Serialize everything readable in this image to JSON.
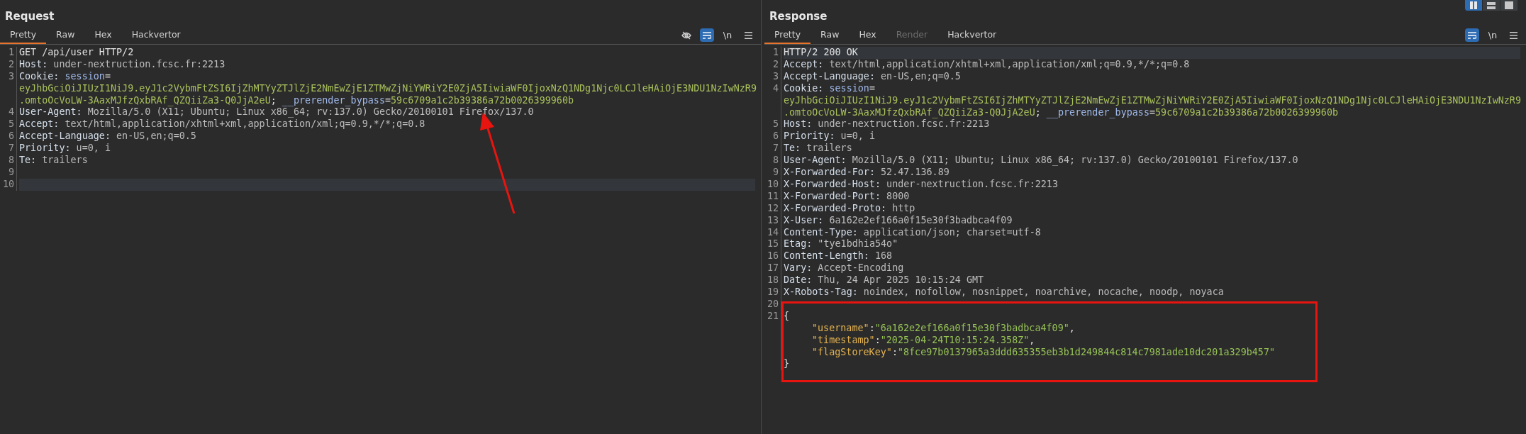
{
  "layout_toggles": [
    {
      "kind": "columns",
      "selected": true
    },
    {
      "kind": "rows",
      "selected": false
    },
    {
      "kind": "single",
      "selected": false
    }
  ],
  "panels": [
    {
      "title": "Request",
      "tabs": [
        {
          "label": "Pretty",
          "selected": true,
          "disabled": false
        },
        {
          "label": "Raw",
          "selected": false,
          "disabled": false
        },
        {
          "label": "Hex",
          "selected": false,
          "disabled": false
        },
        {
          "label": "Hackvertor",
          "selected": false,
          "disabled": false
        }
      ],
      "toolbar": [
        {
          "kind": "hide",
          "selected": false
        },
        {
          "kind": "wrap",
          "selected": true
        },
        {
          "kind": "newline",
          "label": "\\n",
          "selected": false
        },
        {
          "kind": "menu",
          "selected": false
        }
      ],
      "lines": [
        {
          "number": "1",
          "current": false,
          "rows": [
            {
              "tokens": [
                {
                  "kind": "plain",
                  "text": "GET /api/user HTTP/2"
                }
              ]
            }
          ]
        },
        {
          "number": "2",
          "current": false,
          "rows": [
            {
              "tokens": [
                {
                  "kind": "name",
                  "text": "Host:"
                },
                {
                  "kind": "value",
                  "text": " under-nextruction.fcsc.fr:2213"
                }
              ]
            }
          ]
        },
        {
          "number": "3",
          "current": false,
          "rows": [
            {
              "tokens": [
                {
                  "kind": "name",
                  "text": "Cookie: "
                },
                {
                  "kind": "cookie_name",
                  "text": "session"
                },
                {
                  "kind": "plain",
                  "text": "="
                }
              ]
            },
            {
              "tokens": [
                {
                  "kind": "cookie_value",
                  "text": "eyJhbGciOiJIUzI1NiJ9.eyJ1c2VybmFtZSI6IjZhMTYyZTJlZjE2NmEwZjE1ZTMwZjNiYWRiY2E0ZjA5IiwiaWF0IjoxNzQ1NDg1Njc0LCJleHAiOjE3NDU1NzIwNzR9"
                }
              ]
            },
            {
              "tokens": [
                {
                  "kind": "cookie_value",
                  "text": ".omtoOcVoLW-3AaxMJfzQxbRAf_QZQiiZa3-Q0JjA2eU"
                },
                {
                  "kind": "plain",
                  "text": "; "
                },
                {
                  "kind": "cookie_name",
                  "text": "__prerender_bypass"
                },
                {
                  "kind": "plain",
                  "text": "="
                },
                {
                  "kind": "cookie_value",
                  "text": "59c6709a1c2b39386a72b0026399960b"
                }
              ]
            }
          ]
        },
        {
          "number": "4",
          "current": false,
          "rows": [
            {
              "tokens": [
                {
                  "kind": "name",
                  "text": "User-Agent:"
                },
                {
                  "kind": "value",
                  "text": " Mozilla/5.0 (X11; Ubuntu; Linux x86_64; rv:137.0) Gecko/20100101 Firefox/137.0"
                }
              ]
            }
          ]
        },
        {
          "number": "5",
          "current": false,
          "rows": [
            {
              "tokens": [
                {
                  "kind": "name",
                  "text": "Accept:"
                },
                {
                  "kind": "value",
                  "text": " text/html,application/xhtml+xml,application/xml;q=0.9,*/*;q=0.8"
                }
              ]
            }
          ]
        },
        {
          "number": "6",
          "current": false,
          "rows": [
            {
              "tokens": [
                {
                  "kind": "name",
                  "text": "Accept-Language:"
                },
                {
                  "kind": "value",
                  "text": " en-US,en;q=0.5"
                }
              ]
            }
          ]
        },
        {
          "number": "7",
          "current": false,
          "rows": [
            {
              "tokens": [
                {
                  "kind": "name",
                  "text": "Priority:"
                },
                {
                  "kind": "value",
                  "text": " u=0, i"
                }
              ]
            }
          ]
        },
        {
          "number": "8",
          "current": false,
          "rows": [
            {
              "tokens": [
                {
                  "kind": "name",
                  "text": "Te:"
                },
                {
                  "kind": "value",
                  "text": " trailers"
                }
              ]
            }
          ]
        },
        {
          "number": "9",
          "current": false
        },
        {
          "number": "10",
          "current": true
        }
      ],
      "annotation": {
        "kind": "arrow"
      }
    },
    {
      "title": "Response",
      "tabs": [
        {
          "label": "Pretty",
          "selected": true,
          "disabled": false
        },
        {
          "label": "Raw",
          "selected": false,
          "disabled": false
        },
        {
          "label": "Hex",
          "selected": false,
          "disabled": false
        },
        {
          "label": "Render",
          "selected": false,
          "disabled": true
        },
        {
          "label": "Hackvertor",
          "selected": false,
          "disabled": false
        }
      ],
      "toolbar": [
        {
          "kind": "wrap",
          "selected": true
        },
        {
          "kind": "newline",
          "label": "\\n",
          "selected": false
        },
        {
          "kind": "menu",
          "selected": false
        }
      ],
      "lines": [
        {
          "number": "1",
          "current": true,
          "rows": [
            {
              "tokens": [
                {
                  "kind": "plain",
                  "text": "HTTP/2 200 OK"
                }
              ]
            }
          ]
        },
        {
          "number": "2",
          "current": false,
          "rows": [
            {
              "tokens": [
                {
                  "kind": "name",
                  "text": "Accept:"
                },
                {
                  "kind": "value",
                  "text": " text/html,application/xhtml+xml,application/xml;q=0.9,*/*;q=0.8"
                }
              ]
            }
          ]
        },
        {
          "number": "3",
          "current": false,
          "rows": [
            {
              "tokens": [
                {
                  "kind": "name",
                  "text": "Accept-Language:"
                },
                {
                  "kind": "value",
                  "text": " en-US,en;q=0.5"
                }
              ]
            }
          ]
        },
        {
          "number": "4",
          "current": false,
          "rows": [
            {
              "tokens": [
                {
                  "kind": "name",
                  "text": "Cookie: "
                },
                {
                  "kind": "cookie_name",
                  "text": "session"
                },
                {
                  "kind": "plain",
                  "text": "="
                }
              ]
            },
            {
              "tokens": [
                {
                  "kind": "cookie_value",
                  "text": "eyJhbGciOiJIUzI1NiJ9.eyJ1c2VybmFtZSI6IjZhMTYyZTJlZjE2NmEwZjE1ZTMwZjNiYWRiY2E0ZjA5IiwiaWF0IjoxNzQ1NDg1Njc0LCJleHAiOjE3NDU1NzIwNzR9"
                }
              ]
            },
            {
              "tokens": [
                {
                  "kind": "cookie_value",
                  "text": ".omtoOcVoLW-3AaxMJfzQxbRAf_QZQiiZa3-Q0JjA2eU"
                },
                {
                  "kind": "plain",
                  "text": "; "
                },
                {
                  "kind": "cookie_name",
                  "text": "__prerender_bypass"
                },
                {
                  "kind": "plain",
                  "text": "="
                },
                {
                  "kind": "cookie_value",
                  "text": "59c6709a1c2b39386a72b0026399960b"
                }
              ]
            }
          ]
        },
        {
          "number": "5",
          "current": false,
          "rows": [
            {
              "tokens": [
                {
                  "kind": "name",
                  "text": "Host:"
                },
                {
                  "kind": "value",
                  "text": " under-nextruction.fcsc.fr:2213"
                }
              ]
            }
          ]
        },
        {
          "number": "6",
          "current": false,
          "rows": [
            {
              "tokens": [
                {
                  "kind": "name",
                  "text": "Priority:"
                },
                {
                  "kind": "value",
                  "text": " u=0, i"
                }
              ]
            }
          ]
        },
        {
          "number": "7",
          "current": false,
          "rows": [
            {
              "tokens": [
                {
                  "kind": "name",
                  "text": "Te:"
                },
                {
                  "kind": "value",
                  "text": " trailers"
                }
              ]
            }
          ]
        },
        {
          "number": "8",
          "current": false,
          "rows": [
            {
              "tokens": [
                {
                  "kind": "name",
                  "text": "User-Agent:"
                },
                {
                  "kind": "value",
                  "text": " Mozilla/5.0 (X11; Ubuntu; Linux x86_64; rv:137.0) Gecko/20100101 Firefox/137.0"
                }
              ]
            }
          ]
        },
        {
          "number": "9",
          "current": false,
          "rows": [
            {
              "tokens": [
                {
                  "kind": "name",
                  "text": "X-Forwarded-For:"
                },
                {
                  "kind": "value",
                  "text": " 52.47.136.89"
                }
              ]
            }
          ]
        },
        {
          "number": "10",
          "current": false,
          "rows": [
            {
              "tokens": [
                {
                  "kind": "name",
                  "text": "X-Forwarded-Host:"
                },
                {
                  "kind": "value",
                  "text": " under-nextruction.fcsc.fr:2213"
                }
              ]
            }
          ]
        },
        {
          "number": "11",
          "current": false,
          "rows": [
            {
              "tokens": [
                {
                  "kind": "name",
                  "text": "X-Forwarded-Port:"
                },
                {
                  "kind": "value",
                  "text": " 8000"
                }
              ]
            }
          ]
        },
        {
          "number": "12",
          "current": false,
          "rows": [
            {
              "tokens": [
                {
                  "kind": "name",
                  "text": "X-Forwarded-Proto:"
                },
                {
                  "kind": "value",
                  "text": " http"
                }
              ]
            }
          ]
        },
        {
          "number": "13",
          "current": false,
          "rows": [
            {
              "tokens": [
                {
                  "kind": "name",
                  "text": "X-User:"
                },
                {
                  "kind": "value",
                  "text": " 6a162e2ef166a0f15e30f3badbca4f09"
                }
              ]
            }
          ]
        },
        {
          "number": "14",
          "current": false,
          "rows": [
            {
              "tokens": [
                {
                  "kind": "name",
                  "text": "Content-Type:"
                },
                {
                  "kind": "value",
                  "text": " application/json; charset=utf-8"
                }
              ]
            }
          ]
        },
        {
          "number": "15",
          "current": false,
          "rows": [
            {
              "tokens": [
                {
                  "kind": "name",
                  "text": "Etag:"
                },
                {
                  "kind": "value",
                  "text": " \"tye1bdhia54o\""
                }
              ]
            }
          ]
        },
        {
          "number": "16",
          "current": false,
          "rows": [
            {
              "tokens": [
                {
                  "kind": "name",
                  "text": "Content-Length:"
                },
                {
                  "kind": "value",
                  "text": " 168"
                }
              ]
            }
          ]
        },
        {
          "number": "17",
          "current": false,
          "rows": [
            {
              "tokens": [
                {
                  "kind": "name",
                  "text": "Vary:"
                },
                {
                  "kind": "value",
                  "text": " Accept-Encoding"
                }
              ]
            }
          ]
        },
        {
          "number": "18",
          "current": false,
          "rows": [
            {
              "tokens": [
                {
                  "kind": "name",
                  "text": "Date:"
                },
                {
                  "kind": "value",
                  "text": " Thu, 24 Apr 2025 10:15:24 GMT"
                }
              ]
            }
          ]
        },
        {
          "number": "19",
          "current": false,
          "rows": [
            {
              "tokens": [
                {
                  "kind": "name",
                  "text": "X-Robots-Tag:"
                },
                {
                  "kind": "value",
                  "text": " noindex, nofollow, nosnippet, noarchive, nocache, noodp, noyaca"
                }
              ]
            }
          ]
        },
        {
          "number": "20",
          "current": false
        },
        {
          "number": "21",
          "current": false,
          "rows": [
            {
              "indent": false,
              "tokens": [
                {
                  "kind": "plain",
                  "text": "{"
                }
              ]
            },
            {
              "indent": true,
              "tokens": [
                {
                  "kind": "json_key",
                  "text": "\"username\""
                },
                {
                  "kind": "plain",
                  "text": ":"
                },
                {
                  "kind": "json_value",
                  "text": "\"6a162e2ef166a0f15e30f3badbca4f09\""
                },
                {
                  "kind": "plain",
                  "text": ","
                }
              ]
            },
            {
              "indent": true,
              "tokens": [
                {
                  "kind": "json_key",
                  "text": "\"timestamp\""
                },
                {
                  "kind": "plain",
                  "text": ":"
                },
                {
                  "kind": "json_value",
                  "text": "\"2025-04-24T10:15:24.358Z\""
                },
                {
                  "kind": "plain",
                  "text": ","
                }
              ]
            },
            {
              "indent": true,
              "tokens": [
                {
                  "kind": "json_key",
                  "text": "\"flagStoreKey\""
                },
                {
                  "kind": "plain",
                  "text": ":"
                },
                {
                  "kind": "json_value",
                  "text": "\"8fce97b0137965a3ddd635355eb3b1d249844c814c7981ade10dc201a329b457\""
                }
              ]
            },
            {
              "indent": false,
              "tokens": [
                {
                  "kind": "plain",
                  "text": "}"
                }
              ]
            }
          ]
        }
      ],
      "annotation": {
        "kind": "box"
      }
    }
  ]
}
